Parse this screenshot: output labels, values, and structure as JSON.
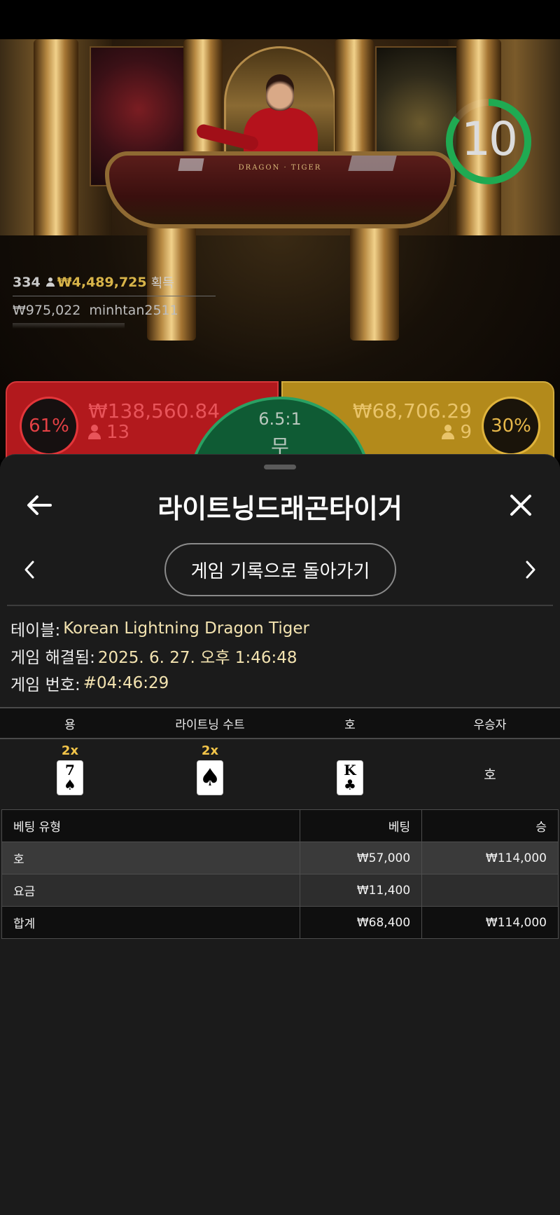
{
  "video": {
    "timer": "10",
    "timer_fraction": 0.85,
    "table_brand": "DRAGON  ·  TIGER",
    "winners": {
      "count": "334",
      "total": "₩4,489,725",
      "total_label": "획득",
      "entry_amount": "₩975,022",
      "entry_user": "minhtan2511"
    }
  },
  "bets_bar": {
    "dragon": {
      "percent": "61%",
      "amount": "₩138,560.84",
      "players": "13"
    },
    "tiger": {
      "percent": "30%",
      "amount": "₩68,706.29",
      "players": "9"
    },
    "tie": {
      "odds": "6.5:1",
      "label": "무"
    }
  },
  "sheet": {
    "title": "라이트닝드래곤타이거",
    "return_button": "게임 기록으로 돌아가기",
    "info": {
      "table_label": "테이블:",
      "table_value": "Korean Lightning Dragon Tiger",
      "resolved_label": "게임 해결됨:",
      "resolved_value": "2025. 6. 27. 오후 1:46:48",
      "round_label": "게임 번호:",
      "round_value": "#04:46:29"
    },
    "round": {
      "headers": [
        "용",
        "라이트닝 수트",
        "호",
        "우승자"
      ],
      "dragon_card": {
        "multiplier": "2x",
        "rank": "7",
        "suit": "♠"
      },
      "lightning_card": {
        "multiplier": "2x",
        "suit": "♠"
      },
      "tiger_card": {
        "rank": "K",
        "suit": "♣"
      },
      "winner": "호"
    },
    "bets": {
      "headers": [
        "베팅 유형",
        "베팅",
        "승"
      ],
      "rows": [
        [
          "호",
          "₩57,000",
          "₩114,000"
        ],
        [
          "요금",
          "₩11,400",
          ""
        ],
        [
          "합계",
          "₩68,400",
          "₩114,000"
        ]
      ]
    }
  },
  "colors": {
    "dragon": "#b2191d",
    "tiger": "#b38a1b",
    "tie": "#0f5b34",
    "gold_text": "#f2c449",
    "timer_ring": "#1faa52"
  }
}
